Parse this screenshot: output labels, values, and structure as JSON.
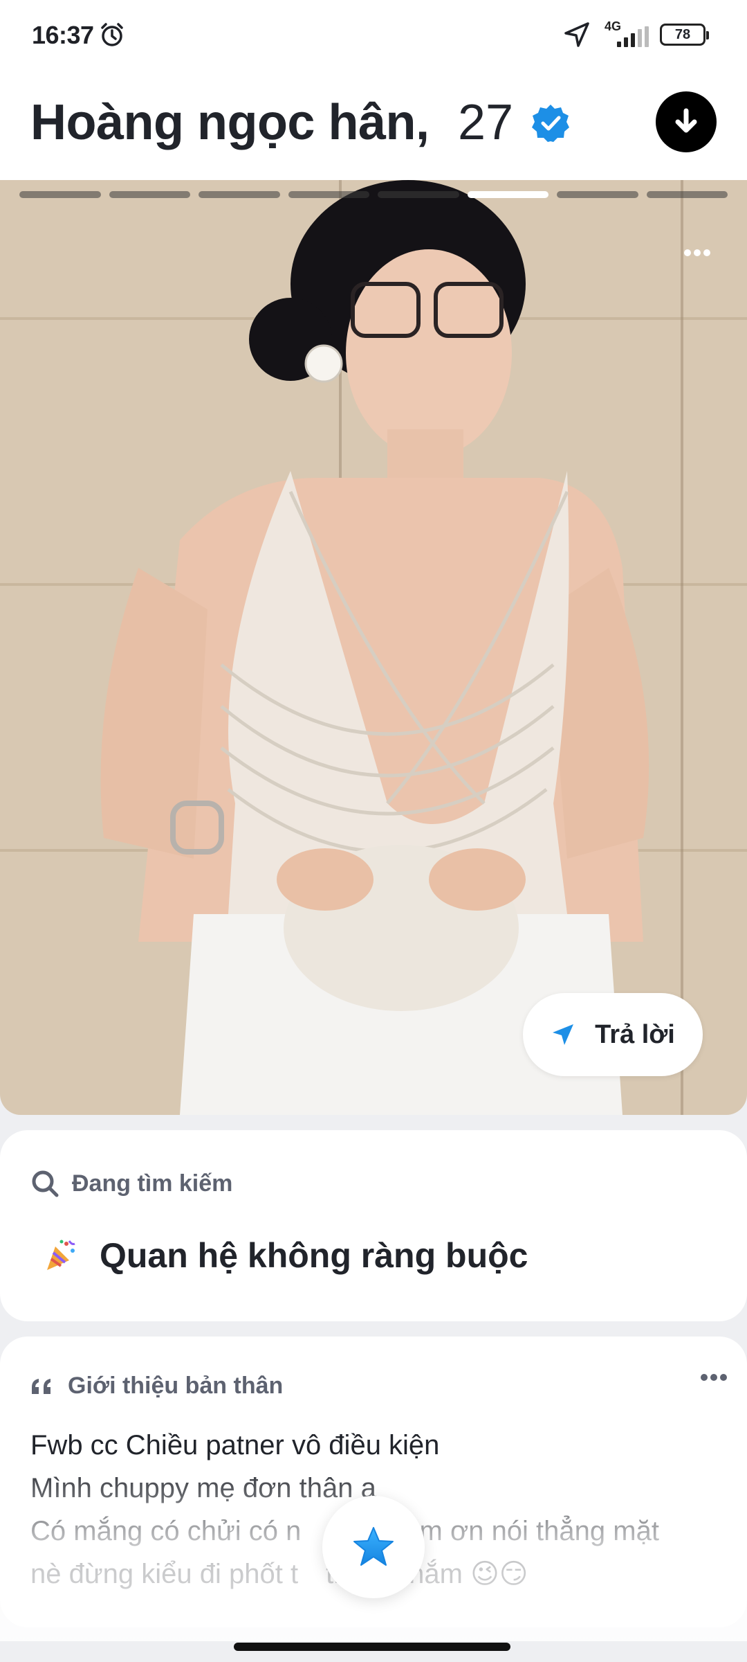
{
  "status_bar": {
    "time": "16:37",
    "network": "4G",
    "battery": "78",
    "icons": [
      "alarm-icon",
      "navigation-arrow-icon",
      "signal-icon",
      "battery-icon"
    ]
  },
  "header": {
    "name": "Hoàng ngọc hân,",
    "age": "27",
    "verified_icon": "verified-badge-icon",
    "action_icon": "download-arrow-icon"
  },
  "photo": {
    "photo_count": 8,
    "active_index": 5,
    "reply_label": "Trả lời",
    "reply_icon": "send-icon"
  },
  "looking_for": {
    "title": "Đang tìm kiếm",
    "value": "Quan hệ không ràng buộc",
    "value_icon": "party-popper-icon"
  },
  "about": {
    "title": "Giới thiệu bản thân",
    "lines": [
      "Fwb cc Chiều patner vô điều kiện",
      "Mình chuppy mẹ đơn thân ạ",
      "Có mắng có chửi có n",
      "làm ơn nói thẳng mặt",
      "nè đừng kiểu đi phốt t",
      "thích nhắm 😉😏"
    ]
  },
  "colors": {
    "accent_blue": "#1d8fe6",
    "text_dark": "#21242b",
    "text_muted": "#5d6270",
    "background": "#eeeff2"
  }
}
